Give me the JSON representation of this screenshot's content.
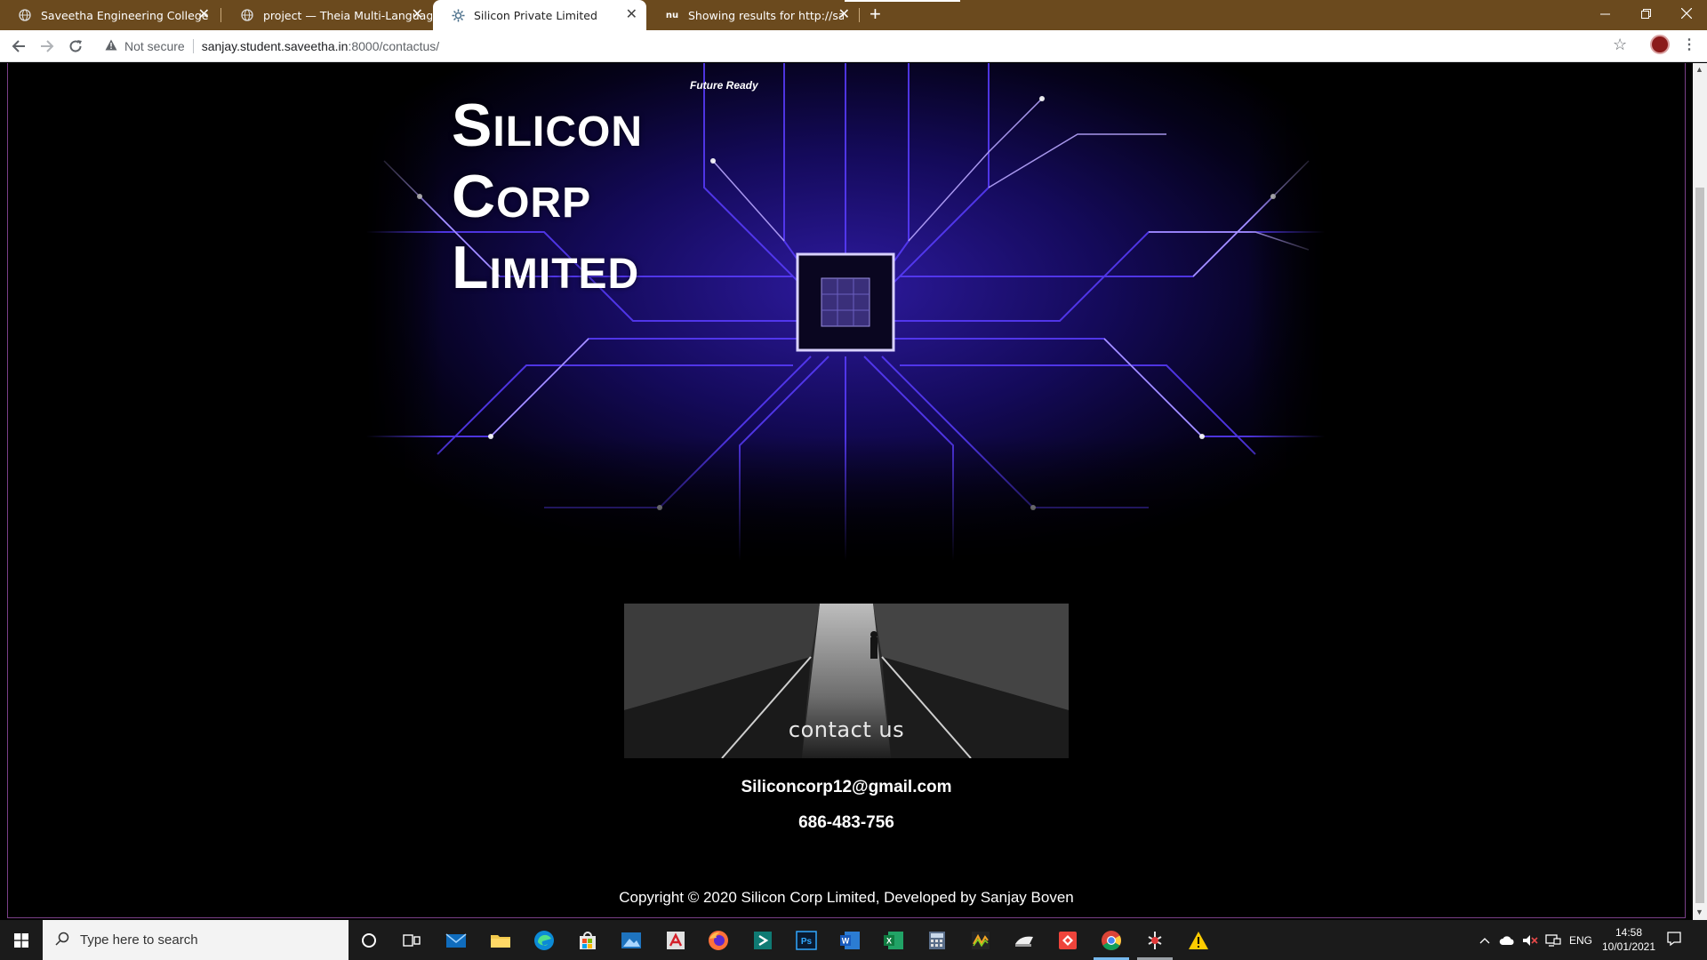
{
  "browser": {
    "tabs": [
      {
        "title": "Saveetha Engineering College",
        "icon": "globe-icon",
        "active": false
      },
      {
        "title": "project — Theia Multi-Language",
        "icon": "globe-icon",
        "active": false
      },
      {
        "title": "Silicon Private Limited",
        "icon": "gear-favicon",
        "active": true
      },
      {
        "title": "Showing results for http://sanjay",
        "icon": "nu-favicon",
        "active": false
      }
    ],
    "tab_close_glyph": "✕",
    "new_tab_glyph": "+",
    "security_label": "Not secure",
    "url_host": "sanjay.student.saveetha.in",
    "url_path": ":8000/contactus/"
  },
  "page": {
    "hero_tagline": "Future Ready",
    "hero_title_lines": [
      "Silicon",
      "Corp",
      "Limited"
    ],
    "contact_banner_label": "contact us",
    "email": "Siliconcorp12@gmail.com",
    "phone": "686-483-756",
    "copyright": "Copyright © 2020 Silicon Corp Limited, Developed by Sanjay Boven"
  },
  "taskbar": {
    "search_placeholder": "Type here to search",
    "language": "ENG",
    "time": "14:58",
    "date": "10/01/2021",
    "pinned_apps": [
      "cortana",
      "task-view",
      "mail",
      "file-explorer",
      "edge",
      "store",
      "photos",
      "acrobat",
      "firefox",
      "sway",
      "photoshop",
      "word",
      "excel",
      "calculator",
      "winamp",
      "typing",
      "anydesk",
      "chrome",
      "git-tool",
      "warning"
    ]
  },
  "colors": {
    "tabbar": "#6b4a1e",
    "page_bg": "#000000",
    "page_border": "#7a3f88",
    "circuit_accent": "#5a2bff"
  }
}
